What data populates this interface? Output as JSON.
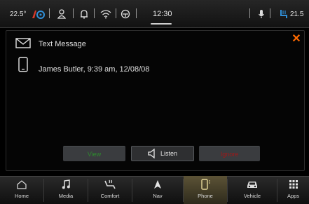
{
  "status_bar": {
    "left_temperature": "22.5°",
    "clock": "12:30",
    "right_temperature": "21.5"
  },
  "message": {
    "title": "Text Message",
    "sender_line": "James Butler, 9:39 am, 12/08/08",
    "icons": {
      "type": "envelope-icon",
      "sender": "phone-icon",
      "close": "close-icon"
    }
  },
  "actions": {
    "view": "View",
    "listen": "Listen",
    "ignore": "Ignore"
  },
  "nav": {
    "items": [
      {
        "label": "Home",
        "icon": "home-icon"
      },
      {
        "label": "Media",
        "icon": "music-note-icon"
      },
      {
        "label": "Comfort",
        "icon": "seat-heat-icon"
      },
      {
        "label": "Nav",
        "icon": "navigation-arrow-icon"
      },
      {
        "label": "Phone",
        "icon": "phone-icon"
      },
      {
        "label": "Vehicle",
        "icon": "car-icon"
      },
      {
        "label": "Apps",
        "icon": "apps-grid-icon"
      }
    ],
    "active_index": 4
  },
  "colors": {
    "accent_close": "#ff6a00",
    "view": "#2e8a2e",
    "ignore": "#a01818",
    "active_nav": "#5c5336"
  }
}
